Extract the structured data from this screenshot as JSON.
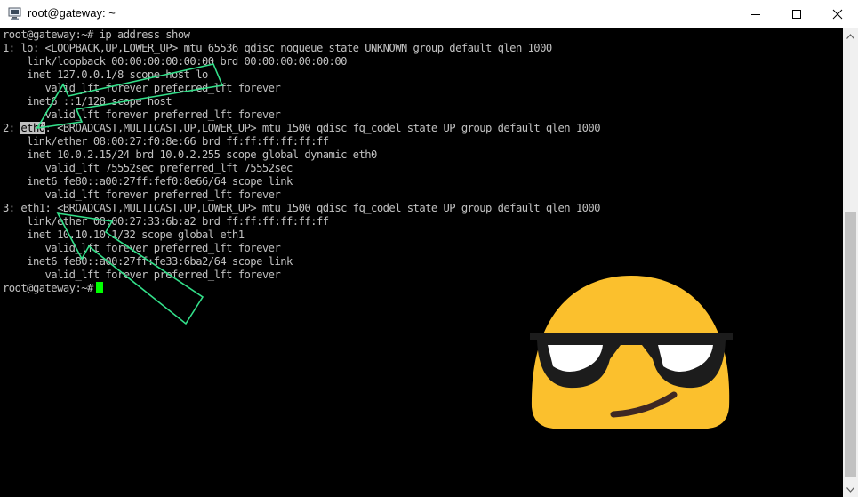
{
  "window": {
    "title": "root@gateway: ~",
    "app_icon": "terminal-computer-icon",
    "controls": [
      "minimize-icon",
      "maximize-icon",
      "close-icon"
    ]
  },
  "terminal": {
    "lines": [
      "root@gateway:~# ip address show",
      "1: lo: <LOOPBACK,UP,LOWER_UP> mtu 65536 qdisc noqueue state UNKNOWN group default qlen 1000",
      "    link/loopback 00:00:00:00:00:00 brd 00:00:00:00:00:00",
      "    inet 127.0.0.1/8 scope host lo",
      "       valid_lft forever preferred_lft forever",
      "    inet6 ::1/128 scope host",
      "       valid_lft forever preferred_lft forever",
      "2: eth0: <BROADCAST,MULTICAST,UP,LOWER_UP> mtu 1500 qdisc fq_codel state UP group default qlen 1000",
      "    link/ether 08:00:27:f0:8e:66 brd ff:ff:ff:ff:ff:ff",
      "    inet 10.0.2.15/24 brd 10.0.2.255 scope global dynamic eth0",
      "       valid_lft 75552sec preferred_lft 75552sec",
      "    inet6 fe80::a00:27ff:fef0:8e66/64 scope link",
      "       valid_lft forever preferred_lft forever",
      "3: eth1: <BROADCAST,MULTICAST,UP,LOWER_UP> mtu 1500 qdisc fq_codel state UP group default qlen 1000",
      "    link/ether 08:00:27:33:6b:a2 brd ff:ff:ff:ff:ff:ff",
      "    inet 10.10.10.1/32 scope global eth1",
      "       valid_lft forever preferred_lft forever",
      "    inet6 fe80::a00:27ff:fe33:6ba2/64 scope link",
      "       valid_lft forever preferred_lft forever"
    ],
    "eth0_line": {
      "prefix": "2: ",
      "highlight": "eth0",
      "rest": ": <BROADCAST,MULTICAST,UP,LOWER_UP> mtu 1500 qdisc fq_codel state UP group default qlen 1000"
    },
    "prompt": "root@gateway:~#",
    "cursor_color": "#00ff00",
    "text_color": "#c0c0c0",
    "background": "#000000"
  },
  "annotations": {
    "arrow_color": "#33e08a",
    "emoji": "smiling-face-with-sunglasses",
    "emoji_color": "#fbc02d"
  }
}
